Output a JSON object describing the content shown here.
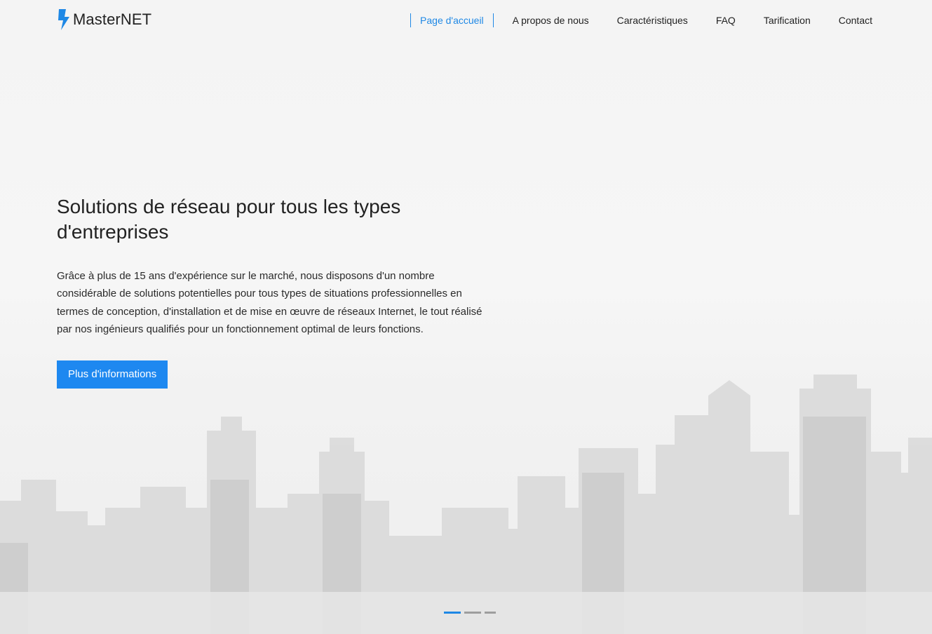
{
  "brand": {
    "name": "MasterNET",
    "icon": "lightning-bolt-icon",
    "accent_color": "#1e88e5"
  },
  "nav": {
    "items": [
      {
        "label": "Page d'accueil",
        "active": true
      },
      {
        "label": "A propos de nous",
        "active": false
      },
      {
        "label": "Caractéristiques",
        "active": false
      },
      {
        "label": "FAQ",
        "active": false
      },
      {
        "label": "Tarification",
        "active": false
      },
      {
        "label": "Contact",
        "active": false
      }
    ]
  },
  "hero": {
    "title": "Solutions de réseau pour tous les types d'entreprises",
    "description": "Grâce à plus de 15 ans d'expérience sur le marché, nous disposons d'un nombre considérable de solutions potentielles pour tous types de situations professionnelles en termes de conception, d'installation et de mise en œuvre de réseaux Internet, le tout réalisé par nos ingénieurs qualifiés pour un fonctionnement optimal de leurs fonctions.",
    "cta_label": "Plus d'informations",
    "cta_color": "#1e88f0"
  },
  "carousel": {
    "slide_count": 3,
    "active_index": 0
  }
}
